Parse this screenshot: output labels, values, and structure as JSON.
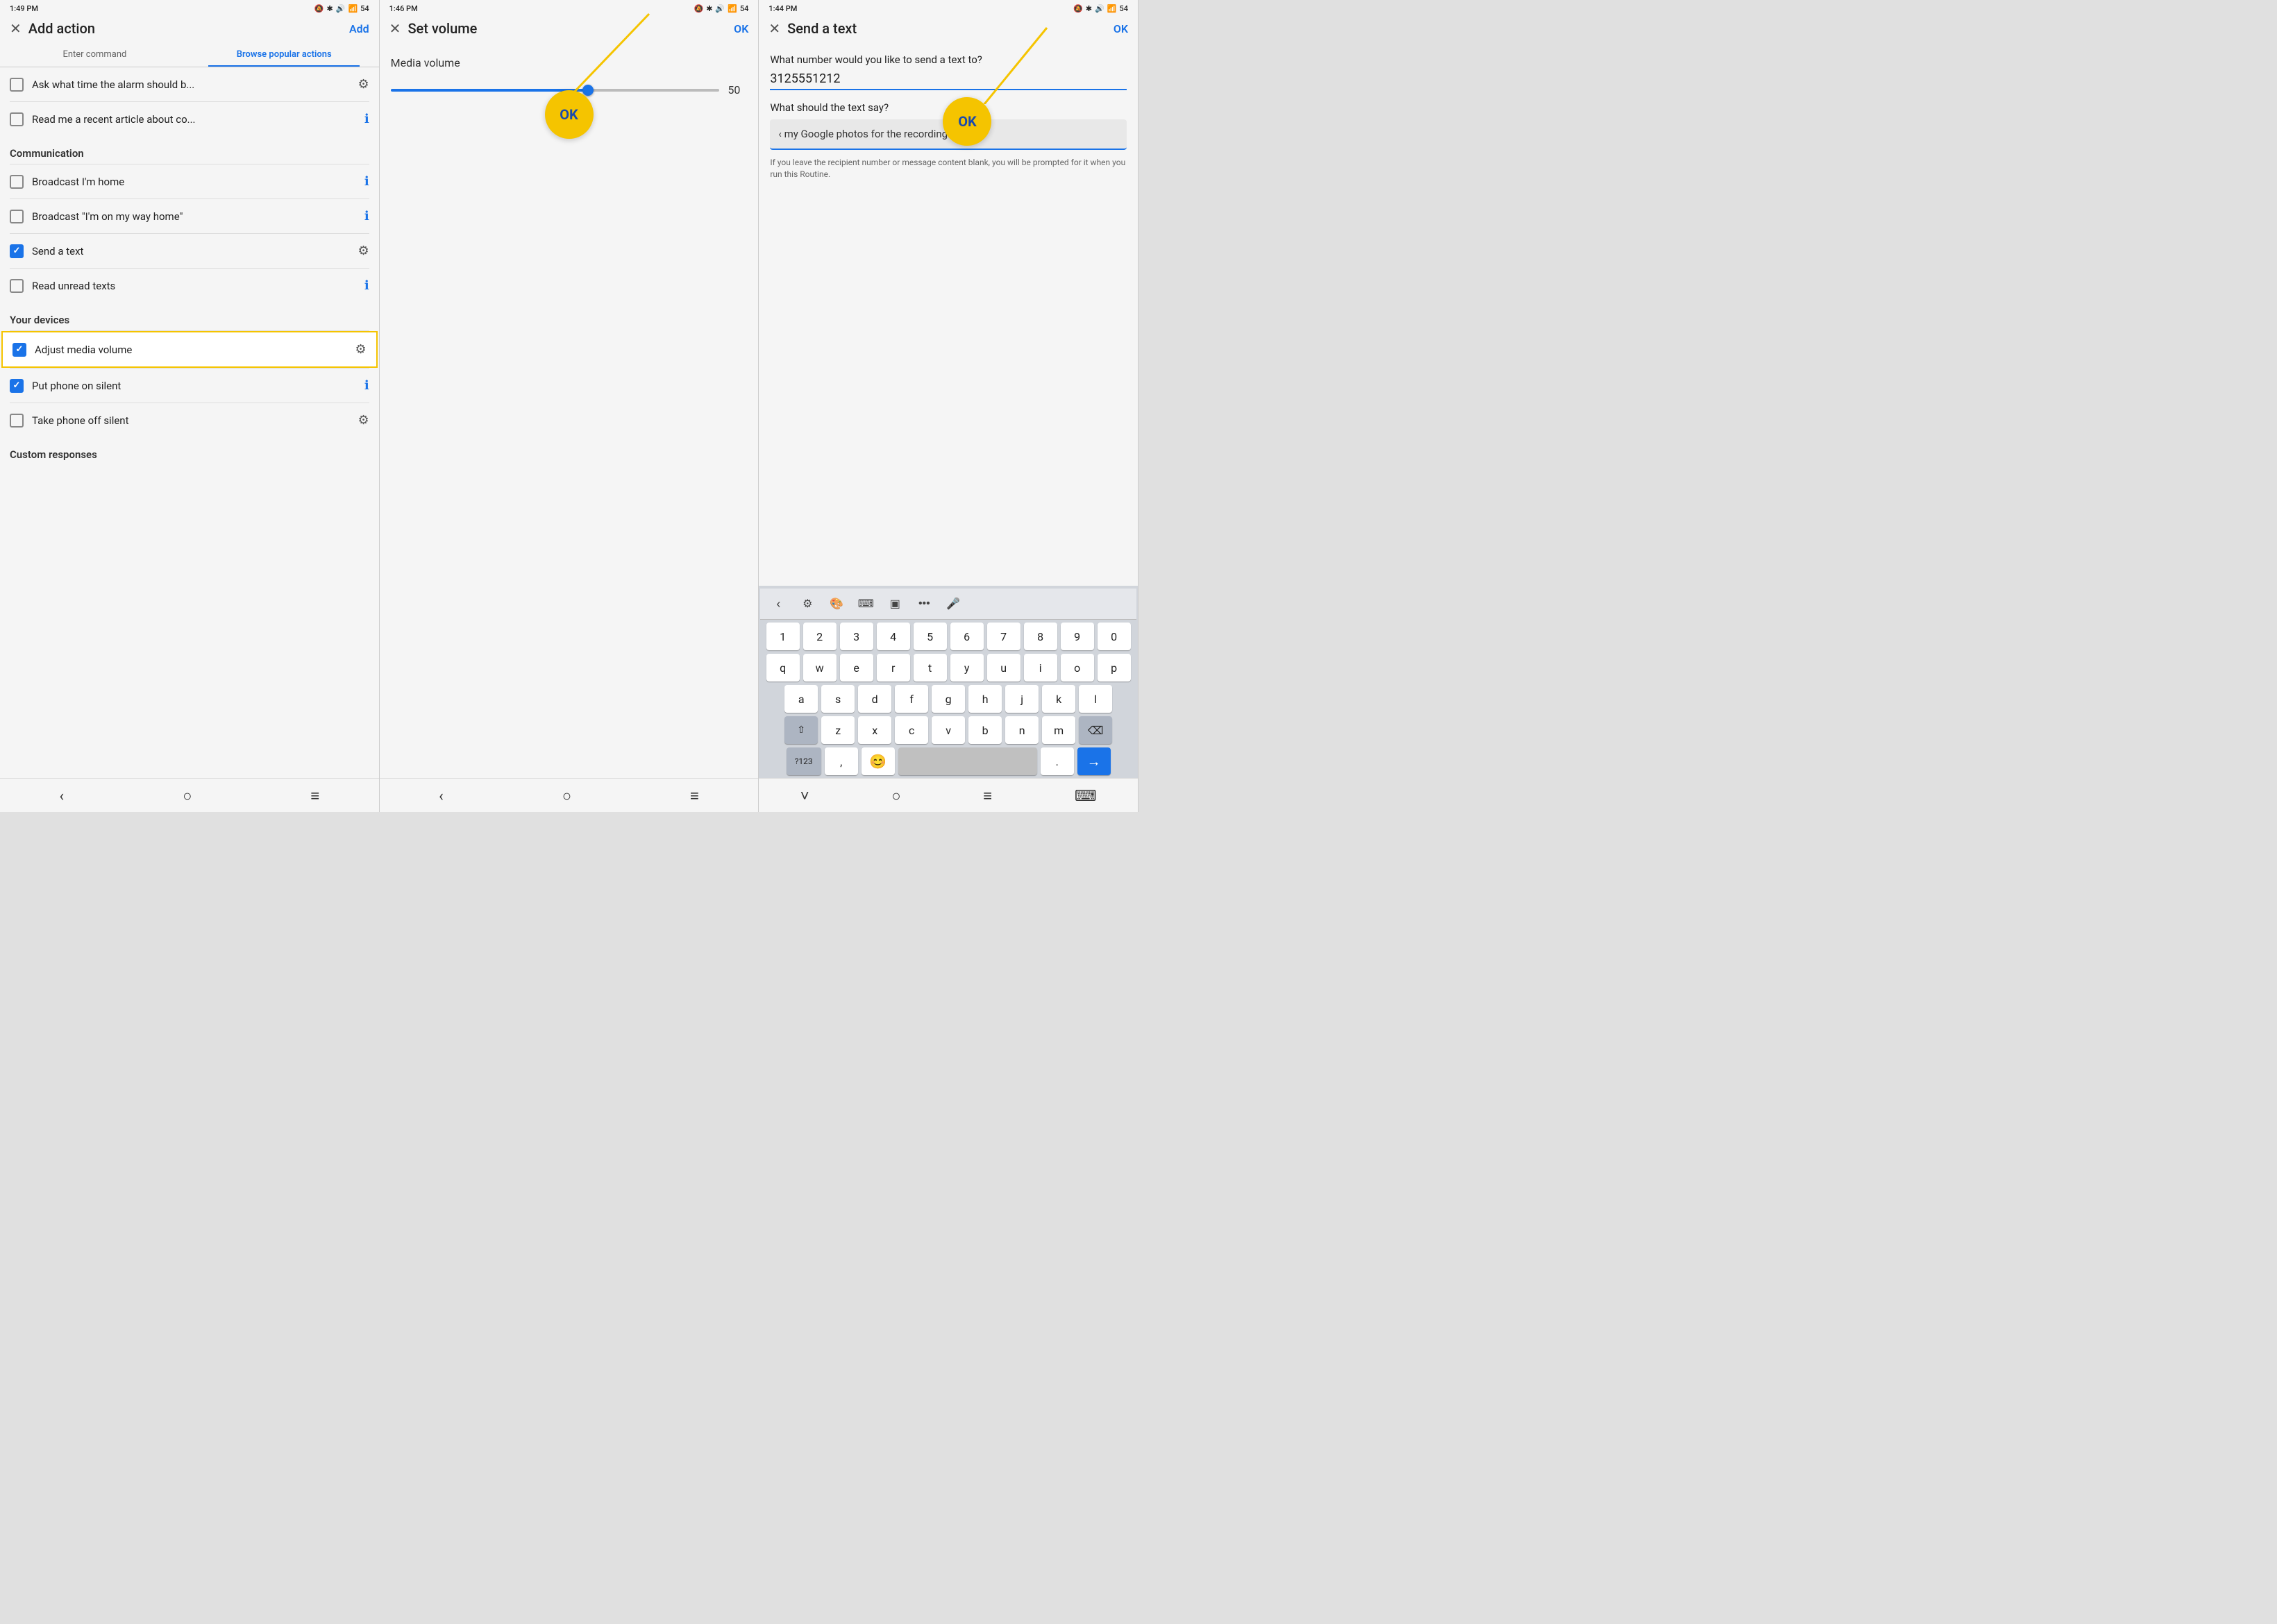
{
  "panel1": {
    "status": {
      "time": "1:49 PM",
      "icons": "🔕 ✱ 🔊 📶 54"
    },
    "header": {
      "close": "✕",
      "title": "Add action",
      "action": "Add"
    },
    "tabs": [
      {
        "label": "Enter command",
        "active": false
      },
      {
        "label": "Browse popular actions",
        "active": true
      }
    ],
    "items_top": [
      {
        "label": "Ask what time the alarm should b...",
        "checked": false,
        "icon": "⚙",
        "icon_type": "gear"
      },
      {
        "label": "Read me a recent article about co...",
        "checked": false,
        "icon": "ℹ",
        "icon_type": "info"
      }
    ],
    "section_communication": "Communication",
    "items_communication": [
      {
        "label": "Broadcast I'm home",
        "checked": false,
        "icon": "ℹ",
        "icon_type": "info"
      },
      {
        "label": "Broadcast \"I'm on my way home\"",
        "checked": false,
        "icon": "ℹ",
        "icon_type": "info"
      },
      {
        "label": "Send a text",
        "checked": true,
        "icon": "⚙",
        "icon_type": "gear"
      },
      {
        "label": "Read unread texts",
        "checked": false,
        "icon": "ℹ",
        "icon_type": "info"
      }
    ],
    "section_devices": "Your devices",
    "items_devices": [
      {
        "label": "Adjust media volume",
        "checked": true,
        "icon": "⚙",
        "icon_type": "gear",
        "highlighted": true
      },
      {
        "label": "Put phone on silent",
        "checked": true,
        "icon": "ℹ",
        "icon_type": "info"
      },
      {
        "label": "Take phone off silent",
        "checked": false,
        "icon": "⚙",
        "icon_type": "gear"
      }
    ],
    "section_custom": "Custom responses",
    "nav": [
      "‹",
      "○",
      "≡"
    ]
  },
  "panel2": {
    "status": {
      "time": "1:46 PM",
      "icons": "🔕 ✱ 🔊 📶 54"
    },
    "header": {
      "close": "✕",
      "title": "Set volume",
      "action": "OK"
    },
    "volume_label": "Media volume",
    "slider_value": "50",
    "ok_badge": "OK",
    "nav": [
      "‹",
      "○",
      "≡"
    ]
  },
  "panel3": {
    "status": {
      "time": "1:44 PM",
      "icons": "🔕 ✱ 🔊 📶 54"
    },
    "header": {
      "close": "✕",
      "title": "Send a text",
      "action": "OK"
    },
    "question1": "What number would you like to send a text to?",
    "phone_number": "3125551212",
    "question2": "What should the text say?",
    "message_preview": "‹ my Google photos for the recording.",
    "hint": "If you leave the recipient number or message content blank, you will be prompted for it when you run this Routine.",
    "ok_badge": "OK",
    "keyboard": {
      "toolbar_icons": [
        "‹",
        "⚙",
        "🎨",
        "⌨",
        "▣",
        "…",
        "🎤"
      ],
      "row_numbers": [
        "1",
        "2",
        "3",
        "4",
        "5",
        "6",
        "7",
        "8",
        "9",
        "0"
      ],
      "row_q": [
        "q",
        "w",
        "e",
        "r",
        "t",
        "y",
        "u",
        "i",
        "o",
        "p"
      ],
      "row_a": [
        "a",
        "s",
        "d",
        "f",
        "g",
        "h",
        "j",
        "k",
        "l"
      ],
      "row_z": [
        "⇧",
        "z",
        "x",
        "c",
        "v",
        "b",
        "n",
        "m",
        "⌫"
      ],
      "row_bottom": [
        "?123",
        ",",
        "😊",
        "",
        ".",
        "→"
      ]
    },
    "nav": [
      "˅",
      "○",
      "≡",
      "⌨"
    ]
  }
}
